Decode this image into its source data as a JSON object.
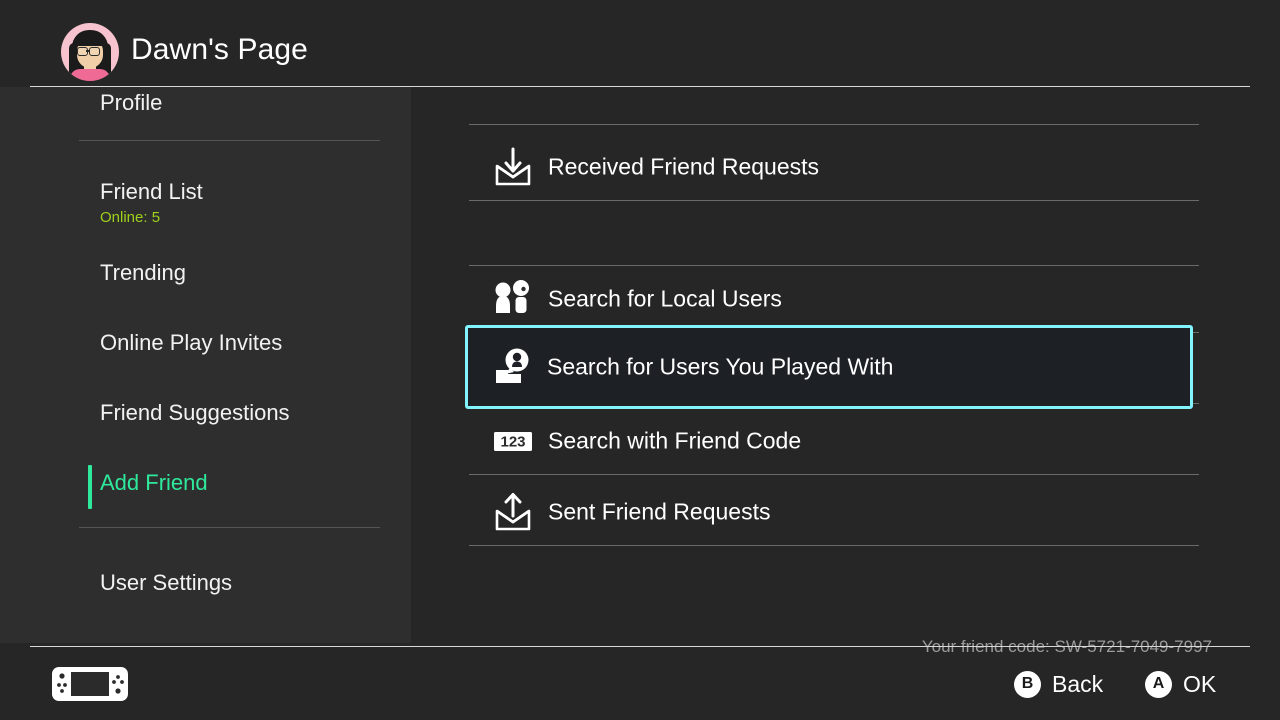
{
  "header": {
    "title": "Dawn's Page",
    "avatar_name": "mii-avatar"
  },
  "sidebar": {
    "items": [
      {
        "label": "Profile",
        "sub": null,
        "active": false
      },
      {
        "label": "Friend List",
        "sub": "Online: 5",
        "active": false
      },
      {
        "label": "Trending",
        "sub": null,
        "active": false
      },
      {
        "label": "Online Play Invites",
        "sub": null,
        "active": false
      },
      {
        "label": "Friend Suggestions",
        "sub": null,
        "active": false
      },
      {
        "label": "Add Friend",
        "sub": null,
        "active": true
      },
      {
        "label": "User Settings",
        "sub": null,
        "active": false
      }
    ],
    "online_count_color": "#9ed11a",
    "active_color": "#2ee89c"
  },
  "main": {
    "rows": [
      {
        "label": "Received Friend Requests",
        "icon": "inbox-envelope-icon",
        "selected": false
      },
      {
        "label": "Search for Local Users",
        "icon": "two-users-icon",
        "selected": false
      },
      {
        "label": "Search for Users You Played With",
        "icon": "played-with-icon",
        "selected": true
      },
      {
        "label": "Search with Friend Code",
        "icon": "numeric-123-icon",
        "selected": false
      },
      {
        "label": "Sent Friend Requests",
        "icon": "outbox-envelope-icon",
        "selected": false
      }
    ],
    "friend_code": "Your friend code: SW-5721-7049-7997",
    "selection_color": "#82f4ff"
  },
  "footer": {
    "console_icon": "switch-console-icon",
    "back_button": "B",
    "back_label": "Back",
    "ok_button": "A",
    "ok_label": "OK"
  }
}
